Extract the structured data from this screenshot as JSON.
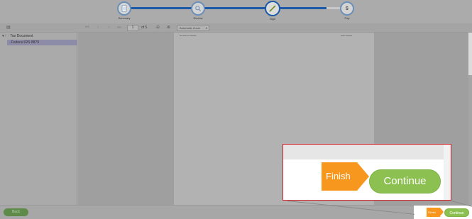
{
  "stepper": {
    "steps": [
      {
        "label": "Summary",
        "icon": "document-icon",
        "state": "done"
      },
      {
        "label": "Review",
        "icon": "magnifier-icon",
        "state": "done"
      },
      {
        "label": "Sign",
        "icon": "pen-icon",
        "state": "active"
      },
      {
        "label": "Pay",
        "icon": "dollar-icon",
        "state": "todo"
      }
    ],
    "colors": {
      "progress": "#1b5aa6",
      "pending": "#c8c8c8"
    }
  },
  "toolbar": {
    "page_number": "1",
    "page_of": "of 5",
    "zoom_value": "Automatic Zoom"
  },
  "sidebar": {
    "root_label": "Tax Document",
    "child_label": "Federal IRS 8879"
  },
  "nav": {
    "back_label": "Back",
    "finish_small_label": "Finish",
    "continue_small_label": "Continue"
  },
  "callout": {
    "finish_label": "Finish",
    "continue_label": "Continue",
    "colors": {
      "finish": "#f7971e",
      "continue": "#8cc152",
      "border": "#d2232a"
    }
  }
}
